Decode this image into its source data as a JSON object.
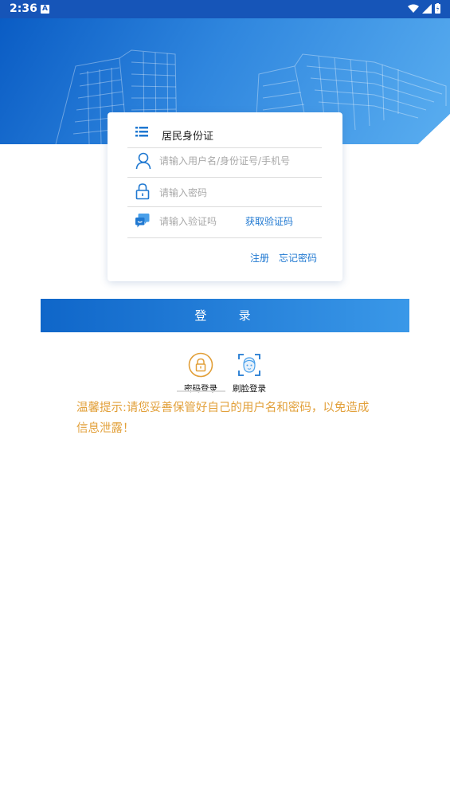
{
  "status_bar": {
    "time": "2:36",
    "notification_icon": "A"
  },
  "card": {
    "title": "居民身份证",
    "username_placeholder": "请输入用户名/身份证号/手机号",
    "password_placeholder": "请输入密码",
    "captcha_placeholder": "请输入验证吗",
    "get_code_label": "获取验证码",
    "register_label": "注册",
    "forgot_label": "忘记密码"
  },
  "login_button": "登 录",
  "methods": {
    "password_login": "密码登录",
    "face_login": "刷脸登录"
  },
  "tip": "温馨提示:请您妥善保管好自己的用户名和密码，以免造成信息泄露！",
  "colors": {
    "accent": "#1f78d1",
    "tip": "#e2a03a",
    "button_start": "#0f66c9",
    "button_end": "#3a98e8"
  }
}
